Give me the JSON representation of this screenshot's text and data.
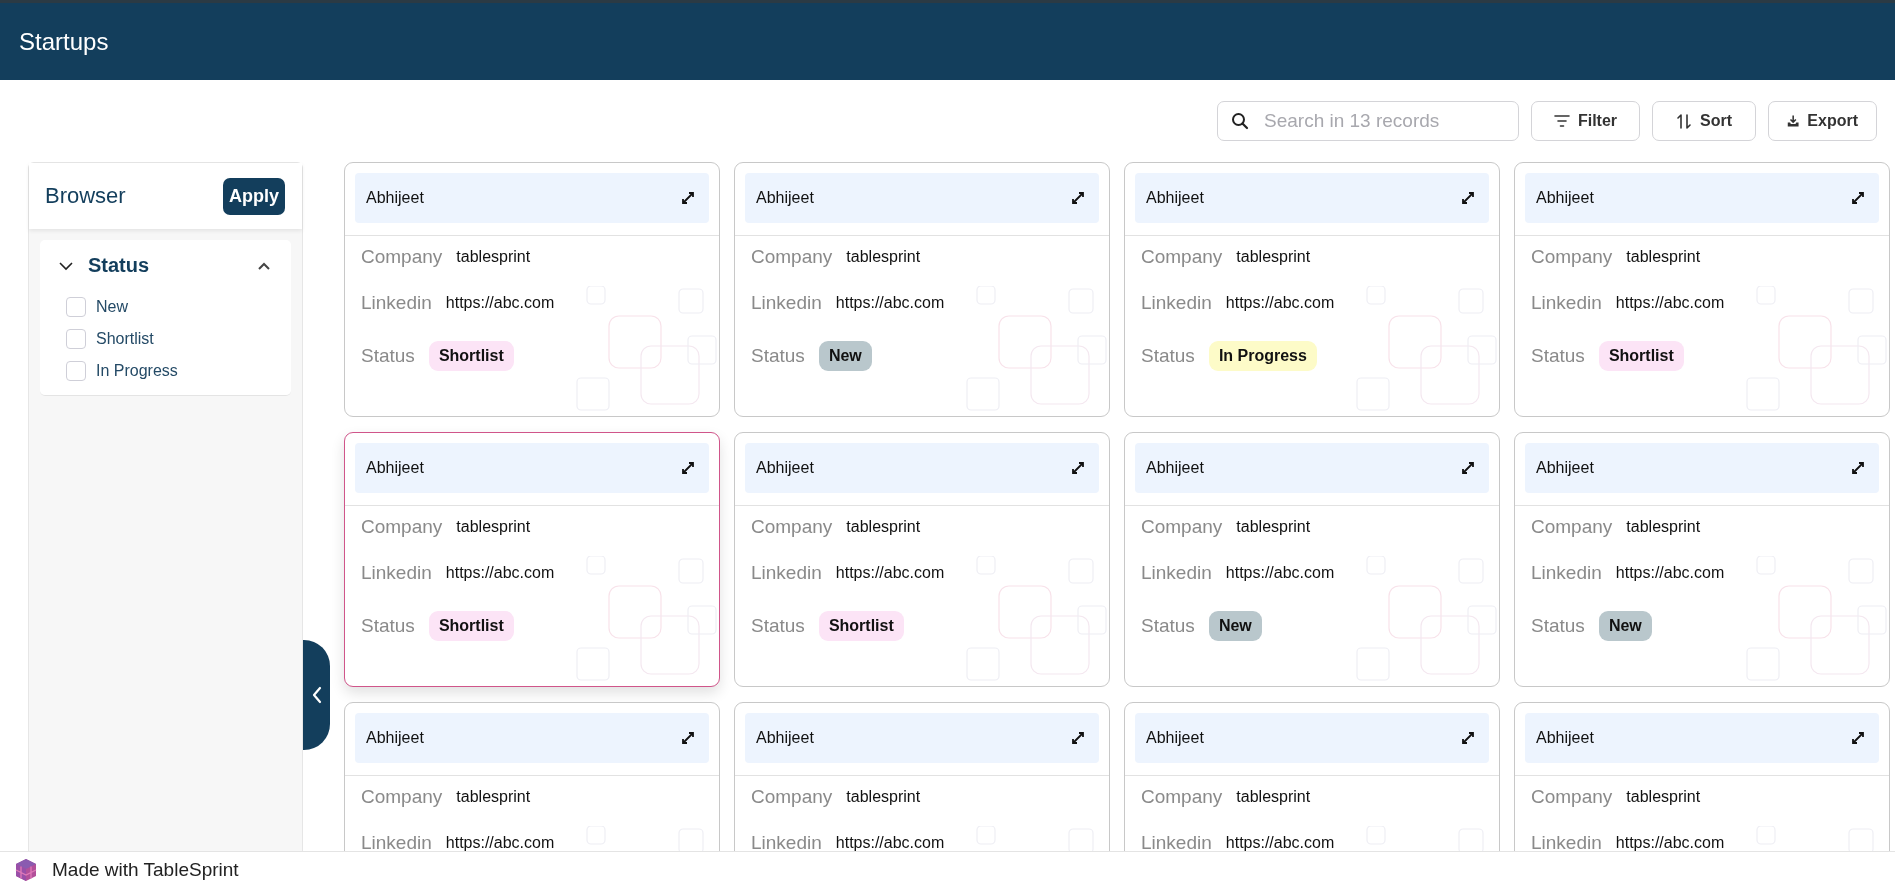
{
  "header": {
    "title": "Startups"
  },
  "toolbar": {
    "search": {
      "placeholder": "Search in 13 records"
    },
    "buttons": [
      {
        "kind": "filter",
        "label": "Filter"
      },
      {
        "kind": "sort",
        "label": "Sort"
      },
      {
        "kind": "export",
        "label": "Export"
      }
    ]
  },
  "sidebar": {
    "title": "Browser",
    "apply_button": "Apply",
    "group": {
      "title": "Status",
      "expanded": true,
      "options": [
        {
          "label": "New",
          "checked": false
        },
        {
          "label": "Shortlist",
          "checked": false
        },
        {
          "label": "In Progress",
          "checked": false
        }
      ]
    }
  },
  "cards": [
    {
      "name": "Abhijeet",
      "selected": false,
      "fields": [
        {
          "kind": "text",
          "label": "Company",
          "value": "tablesprint"
        },
        {
          "kind": "text",
          "label": "Linkedin",
          "value": "https://abc.com"
        },
        {
          "kind": "badge",
          "label": "Status",
          "value": "Shortlist",
          "color": "#fce4f6"
        }
      ]
    },
    {
      "name": "Abhijeet",
      "selected": false,
      "fields": [
        {
          "kind": "text",
          "label": "Company",
          "value": "tablesprint"
        },
        {
          "kind": "text",
          "label": "Linkedin",
          "value": "https://abc.com"
        },
        {
          "kind": "badge",
          "label": "Status",
          "value": "New",
          "color": "#b9c7cc"
        }
      ]
    },
    {
      "name": "Abhijeet",
      "selected": false,
      "fields": [
        {
          "kind": "text",
          "label": "Company",
          "value": "tablesprint"
        },
        {
          "kind": "text",
          "label": "Linkedin",
          "value": "https://abc.com"
        },
        {
          "kind": "badge",
          "label": "Status",
          "value": "In Progress",
          "color": "#fdfbc8"
        }
      ]
    },
    {
      "name": "Abhijeet",
      "selected": false,
      "fields": [
        {
          "kind": "text",
          "label": "Company",
          "value": "tablesprint"
        },
        {
          "kind": "text",
          "label": "Linkedin",
          "value": "https://abc.com"
        },
        {
          "kind": "badge",
          "label": "Status",
          "value": "Shortlist",
          "color": "#fce4f6"
        }
      ]
    },
    {
      "name": "Abhijeet",
      "selected": true,
      "fields": [
        {
          "kind": "text",
          "label": "Company",
          "value": "tablesprint"
        },
        {
          "kind": "text",
          "label": "Linkedin",
          "value": "https://abc.com"
        },
        {
          "kind": "badge",
          "label": "Status",
          "value": "Shortlist",
          "color": "#fce4f6"
        }
      ]
    },
    {
      "name": "Abhijeet",
      "selected": false,
      "fields": [
        {
          "kind": "text",
          "label": "Company",
          "value": "tablesprint"
        },
        {
          "kind": "text",
          "label": "Linkedin",
          "value": "https://abc.com"
        },
        {
          "kind": "badge",
          "label": "Status",
          "value": "Shortlist",
          "color": "#fce4f6"
        }
      ]
    },
    {
      "name": "Abhijeet",
      "selected": false,
      "fields": [
        {
          "kind": "text",
          "label": "Company",
          "value": "tablesprint"
        },
        {
          "kind": "text",
          "label": "Linkedin",
          "value": "https://abc.com"
        },
        {
          "kind": "badge",
          "label": "Status",
          "value": "New",
          "color": "#b9c7cc"
        }
      ]
    },
    {
      "name": "Abhijeet",
      "selected": false,
      "fields": [
        {
          "kind": "text",
          "label": "Company",
          "value": "tablesprint"
        },
        {
          "kind": "text",
          "label": "Linkedin",
          "value": "https://abc.com"
        },
        {
          "kind": "badge",
          "label": "Status",
          "value": "New",
          "color": "#b9c7cc"
        }
      ]
    },
    {
      "name": "Abhijeet",
      "selected": false,
      "fields": [
        {
          "kind": "text",
          "label": "Company",
          "value": "tablesprint"
        },
        {
          "kind": "text",
          "label": "Linkedin",
          "value": "https://abc.com"
        }
      ]
    },
    {
      "name": "Abhijeet",
      "selected": false,
      "fields": [
        {
          "kind": "text",
          "label": "Company",
          "value": "tablesprint"
        },
        {
          "kind": "text",
          "label": "Linkedin",
          "value": "https://abc.com"
        }
      ]
    },
    {
      "name": "Abhijeet",
      "selected": false,
      "fields": [
        {
          "kind": "text",
          "label": "Company",
          "value": "tablesprint"
        },
        {
          "kind": "text",
          "label": "Linkedin",
          "value": "https://abc.com"
        }
      ]
    },
    {
      "name": "Abhijeet",
      "selected": false,
      "fields": [
        {
          "kind": "text",
          "label": "Company",
          "value": "tablesprint"
        },
        {
          "kind": "text",
          "label": "Linkedin",
          "value": "https://abc.com"
        }
      ]
    }
  ],
  "footer": {
    "text": "Made with TableSprint"
  }
}
